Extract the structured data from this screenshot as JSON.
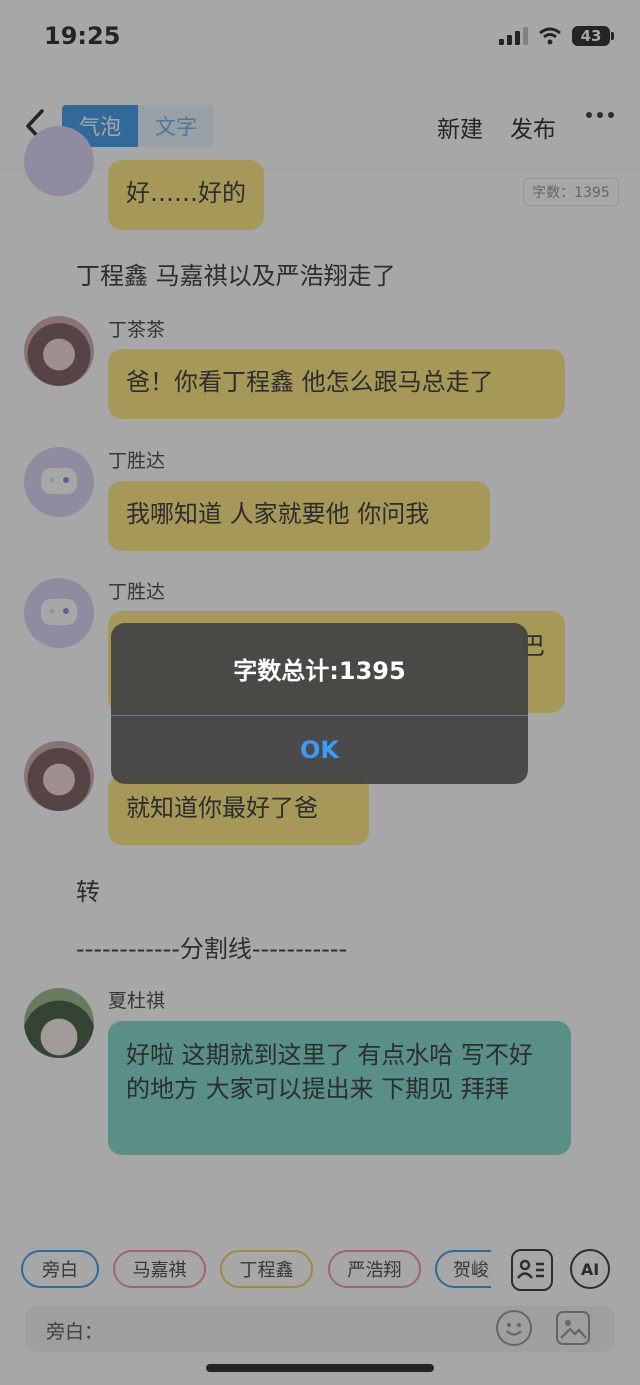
{
  "status": {
    "time": "19:25",
    "battery": "43"
  },
  "header": {
    "tab_bubble": "气泡",
    "tab_text": "文字",
    "new_label": "新建",
    "publish_label": "发布"
  },
  "word_count_badge": "字数：1395",
  "messages": {
    "m1_text": "好……好的",
    "narration1": "丁程鑫 马嘉祺以及严浩翔走了",
    "m2_name": "丁茶茶",
    "m2_text": "爸！你看丁程鑫 他怎么跟马总走了",
    "m3_name": "丁胜达",
    "m3_text": "我哪知道 人家就要他 你问我",
    "m4_name": "丁胜达",
    "m4_text_visible_tail": "巴",
    "m5_text": "就知道你最好了爸",
    "narration2": "转",
    "separator": "------------分割线-----------",
    "m6_name": "夏杜祺",
    "m6_text": "好啦 这期就到这里了 有点水哈 写不好的地方 大家可以提出来 下期见 拜拜"
  },
  "roles": [
    {
      "label": "旁白",
      "color": "#2a8ee6"
    },
    {
      "label": "马嘉祺",
      "color": "#f08a8a"
    },
    {
      "label": "丁程鑫",
      "color": "#f2c94c"
    },
    {
      "label": "严浩翔",
      "color": "#f08a8a"
    },
    {
      "label": "贺峻",
      "color": "#2a8ee6"
    }
  ],
  "ai_label": "AI",
  "input": {
    "label": "旁白："
  },
  "alert": {
    "title": "字数总计:1395",
    "ok_label": "OK"
  }
}
